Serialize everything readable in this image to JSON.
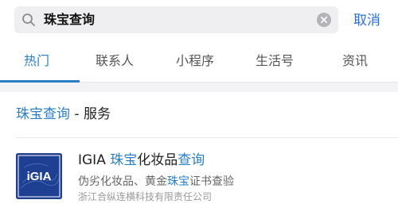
{
  "search": {
    "query": "珠宝查询",
    "cancel_label": "取消"
  },
  "tabs": [
    {
      "label": "热门",
      "active": true
    },
    {
      "label": "联系人",
      "active": false
    },
    {
      "label": "小程序",
      "active": false
    },
    {
      "label": "生活号",
      "active": false
    },
    {
      "label": "资讯",
      "active": false
    }
  ],
  "section": {
    "highlight": "珠宝查询",
    "rest": " - 服务"
  },
  "result": {
    "logo_text": "iGIA",
    "title_parts": [
      "IGIA ",
      "珠宝",
      "化妆品",
      "查询"
    ],
    "desc_parts": [
      "伪劣化妆品、黄金",
      "珠宝",
      "证书查验"
    ],
    "company": "浙江合纵连横科技有限责任公司"
  },
  "colors": {
    "accent": "#2a7ec6",
    "logo_bg": "#1f3f92"
  },
  "icons": {
    "search": "search-icon",
    "clear": "clear-icon"
  }
}
